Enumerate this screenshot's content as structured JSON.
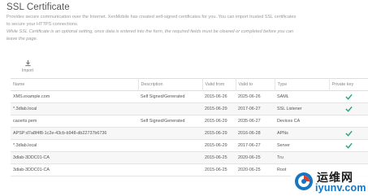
{
  "header": {
    "title": "SSL Certificate",
    "desc_line1": "Provides secure communication over the Internet. XenMobile has created self-signed certificates for you. You can import trusted SSL certificates",
    "desc_line2": "to secure your HTTPS connections.",
    "desc_line3": "While SSL Certificate is an optional setting, once data is entered into the form, the required fields must be cleared or completed before you can",
    "desc_line4": "leave the page."
  },
  "toolbar": {
    "import_label": "Import",
    "import_icon": "import-icon"
  },
  "table": {
    "columns": [
      "Name",
      "Description",
      "Valid from",
      "Valid to",
      "Type",
      "Private key"
    ],
    "rows": [
      {
        "name": "XMS.example.com",
        "description": "Self Signed/Generated",
        "valid_from": "2015-06-26",
        "valid_to": "2025-06-26",
        "type": "SAML",
        "private_key": true
      },
      {
        "name": "*.3dlab.local",
        "description": "",
        "valid_from": "2015-06-29",
        "valid_to": "2017-06-27",
        "type": "SSL Listener",
        "private_key": true
      },
      {
        "name": "cacerts.pem",
        "description": "Self Signed/Generated",
        "valid_from": "2015-06-29",
        "valid_to": "2035-06-27",
        "type": "Devices CA",
        "private_key": false
      },
      {
        "name": "APSP:d7a8f4f8-1c2e-43cb-b948-db22737b6736",
        "description": "",
        "valid_from": "2015-06-29",
        "valid_to": "2016-06-28",
        "type": "APNs",
        "private_key": true
      },
      {
        "name": "*.3dlab.local",
        "description": "",
        "valid_from": "2015-06-29",
        "valid_to": "2017-06-27",
        "type": "Server",
        "private_key": true
      },
      {
        "name": "3dlab-3DDC01-CA",
        "description": "",
        "valid_from": "2015-06-25",
        "valid_to": "2020-06-25",
        "type": "Tru",
        "private_key": false
      },
      {
        "name": "3dlab-3DDC01-CA",
        "description": "",
        "valid_from": "2015-06-25",
        "valid_to": "2020-06-25",
        "type": "Root",
        "private_key": false
      }
    ]
  },
  "watermark": {
    "brand_cn": "运维网",
    "url": "iyunv.com"
  },
  "colors": {
    "check": "#2aa37a",
    "title": "#555555",
    "muted": "#999999",
    "watermark_blue": "#1576c2"
  }
}
